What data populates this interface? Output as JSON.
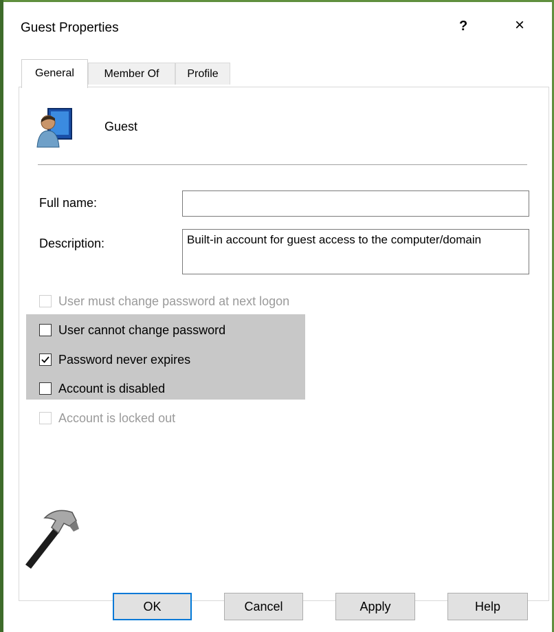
{
  "window": {
    "title": "Guest Properties",
    "help_label": "?",
    "close_label": "×"
  },
  "tabs": [
    {
      "label": "General"
    },
    {
      "label": "Member Of"
    },
    {
      "label": "Profile"
    }
  ],
  "user": {
    "name": "Guest",
    "icon": "user-computer-icon"
  },
  "fields": {
    "full_name_label": "Full name:",
    "full_name_value": "",
    "description_label": "Description:",
    "description_value": "Built-in account for guest access to the computer/domain"
  },
  "checkboxes": [
    {
      "label": "User must change password at next logon",
      "checked": false,
      "enabled": false
    },
    {
      "label": "User cannot change password",
      "checked": false,
      "enabled": true
    },
    {
      "label": "Password never expires",
      "checked": true,
      "enabled": true
    },
    {
      "label": "Account is disabled",
      "checked": false,
      "enabled": true
    },
    {
      "label": "Account is locked out",
      "checked": false,
      "enabled": false
    }
  ],
  "buttons": {
    "ok": "OK",
    "cancel": "Cancel",
    "apply": "Apply",
    "help": "Help"
  },
  "overlay_icon": "hammer-icon",
  "colors": {
    "highlight": "#c8c8c8",
    "default_button_border": "#0078d7",
    "accent": "#5f8f3e"
  }
}
